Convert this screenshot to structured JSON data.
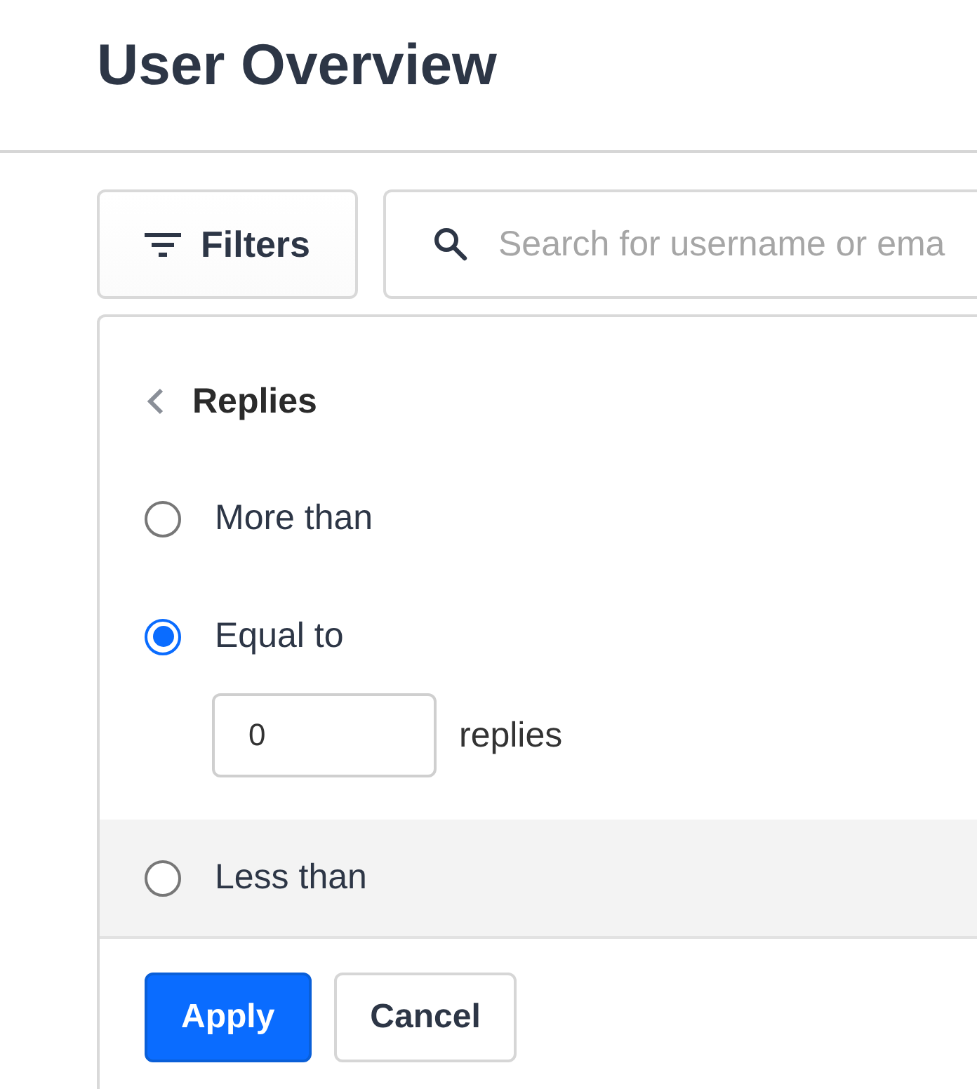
{
  "page": {
    "title": "User Overview"
  },
  "toolbar": {
    "filters_button": "Filters",
    "search": {
      "placeholder": "Search for username or ema"
    }
  },
  "filter_panel": {
    "title": "Replies",
    "options": [
      {
        "label": "More than",
        "selected": false,
        "highlighted": false
      },
      {
        "label": "Equal to",
        "selected": true,
        "highlighted": false,
        "value": "0",
        "unit": "replies"
      },
      {
        "label": "Less than",
        "selected": false,
        "highlighted": true
      }
    ],
    "buttons": [
      {
        "label": "Apply",
        "kind": "primary"
      },
      {
        "label": "Cancel",
        "kind": "secondary"
      }
    ]
  }
}
